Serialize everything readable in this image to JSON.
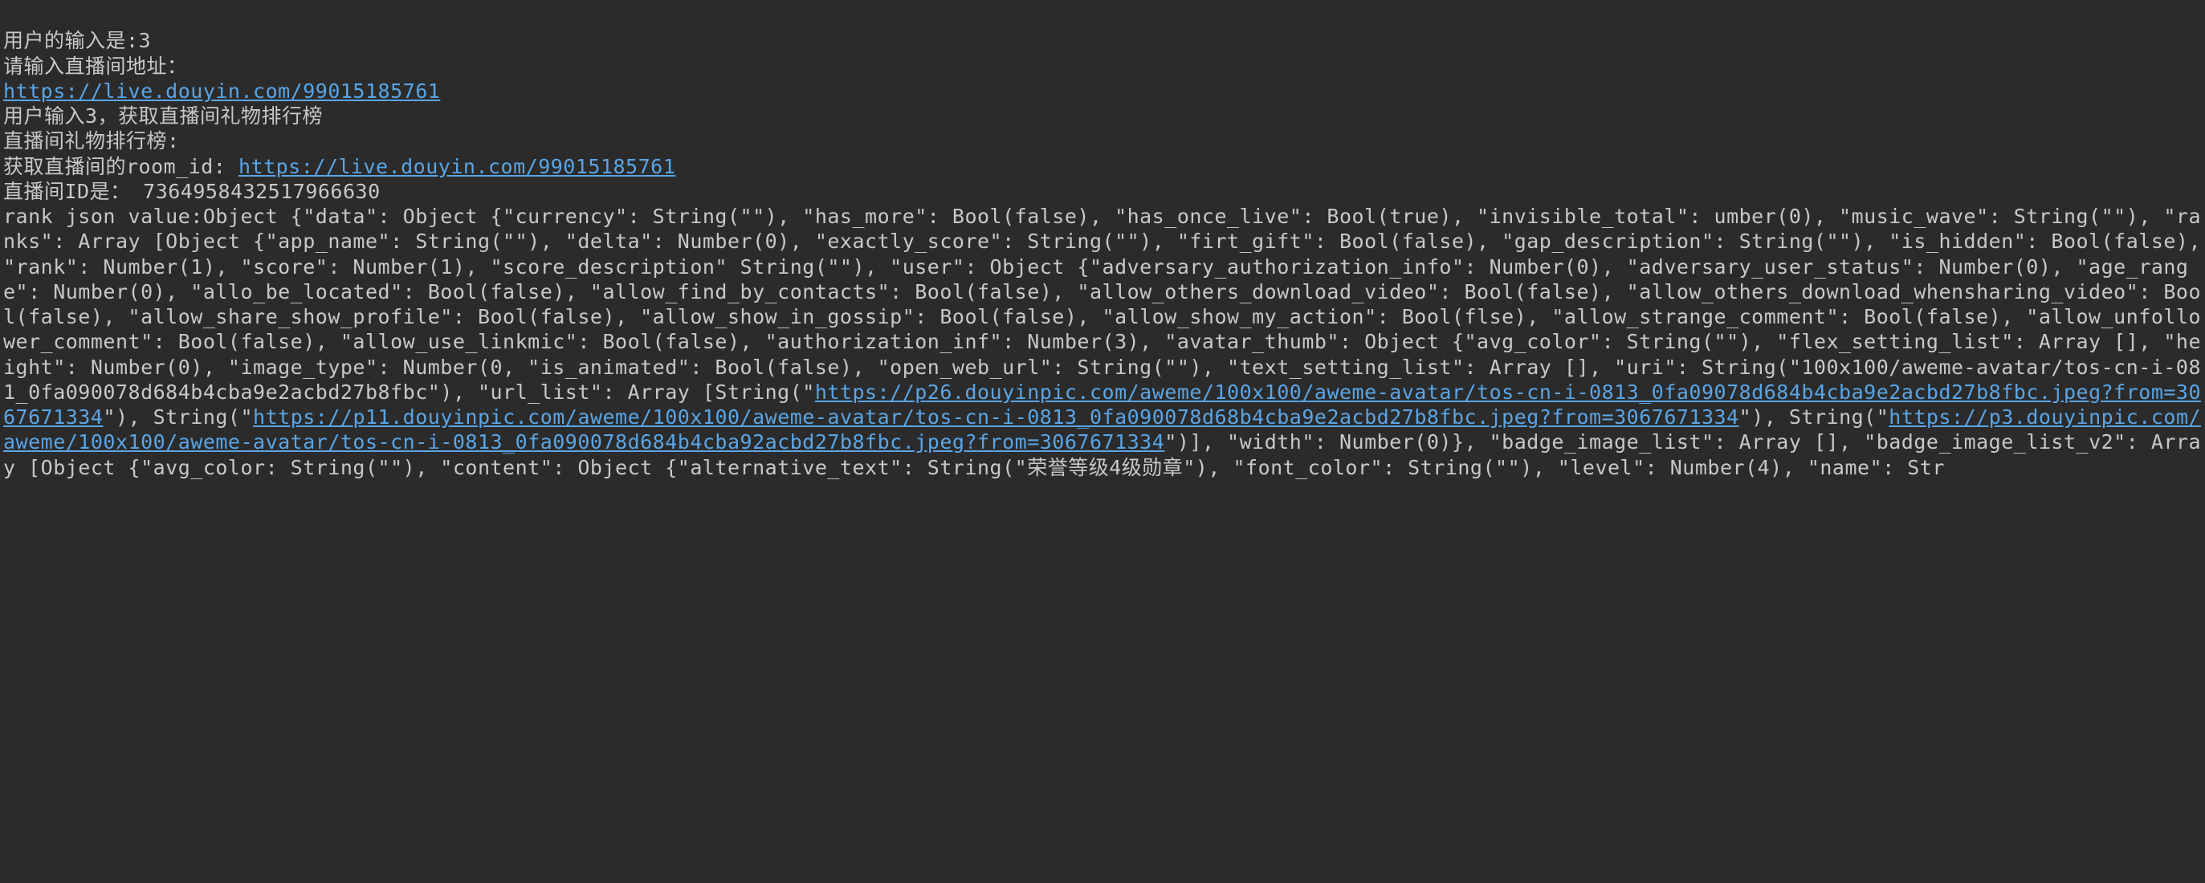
{
  "console": {
    "lines": {
      "l1": "用户的输入是:3",
      "l2": "请输入直播间地址：",
      "l3_url": "https://live.douyin.com/99015185761",
      "l4": "用户输入3，获取直播间礼物排行榜",
      "l5": "直播间礼物排行榜:",
      "l6_prefix": "获取直播间的room_id: ",
      "l6_url": "https://live.douyin.com/99015185761",
      "l7": "直播间ID是： 7364958432517966630"
    },
    "json_dump": {
      "pre_url1": "rank json value:Object {\"data\": Object {\"currency\": String(\"\"), \"has_more\": Bool(false), \"has_once_live\": Bool(true), \"invisible_total\": umber(0), \"music_wave\": String(\"\"), \"ranks\": Array [Object {\"app_name\": String(\"\"), \"delta\": Number(0), \"exactly_score\": String(\"\"), \"firt_gift\": Bool(false), \"gap_description\": String(\"\"), \"is_hidden\": Bool(false), \"rank\": Number(1), \"score\": Number(1), \"score_description\" String(\"\"), \"user\": Object {\"adversary_authorization_info\": Number(0), \"adversary_user_status\": Number(0), \"age_range\": Number(0), \"allo_be_located\": Bool(false), \"allow_find_by_contacts\": Bool(false), \"allow_others_download_video\": Bool(false), \"allow_others_download_whensharing_video\": Bool(false), \"allow_share_show_profile\": Bool(false), \"allow_show_in_gossip\": Bool(false), \"allow_show_my_action\": Bool(flse), \"allow_strange_comment\": Bool(false), \"allow_unfollower_comment\": Bool(false), \"allow_use_linkmic\": Bool(false), \"authorization_inf\": Number(3), \"avatar_thumb\": Object {\"avg_color\": String(\"\"), \"flex_setting_list\": Array [], \"height\": Number(0), \"image_type\": Number(0, \"is_animated\": Bool(false), \"open_web_url\": String(\"\"), \"text_setting_list\": Array [], \"uri\": String(\"100x100/aweme-avatar/tos-cn-i-081_0fa090078d684b4cba9e2acbd27b8fbc\"), \"url_list\": Array [String(\"",
      "url1": "https://p26.douyinpic.com/aweme/100x100/aweme-avatar/tos-cn-i-0813_0fa09078d684b4cba9e2acbd27b8fbc.jpeg?from=3067671334",
      "mid1": "\"), String(\"",
      "url2": "https://p11.douyinpic.com/aweme/100x100/aweme-avatar/tos-cn-i-0813_0fa090078d68b4cba9e2acbd27b8fbc.jpeg?from=3067671334",
      "mid2": "\"), String(\"",
      "url3": "https://p3.douyinpic.com/aweme/100x100/aweme-avatar/tos-cn-i-0813_0fa090078d684b4cba92acbd27b8fbc.jpeg?from=3067671334",
      "post_url3": "\")], \"width\": Number(0)}, \"badge_image_list\": Array [], \"badge_image_list_v2\": Array [Object {\"avg_color: String(\"\"), \"content\": Object {\"alternative_text\": String(\"荣誉等级4级勋章\"), \"font_color\": String(\"\"), \"level\": Number(4), \"name\": Str"
    }
  }
}
